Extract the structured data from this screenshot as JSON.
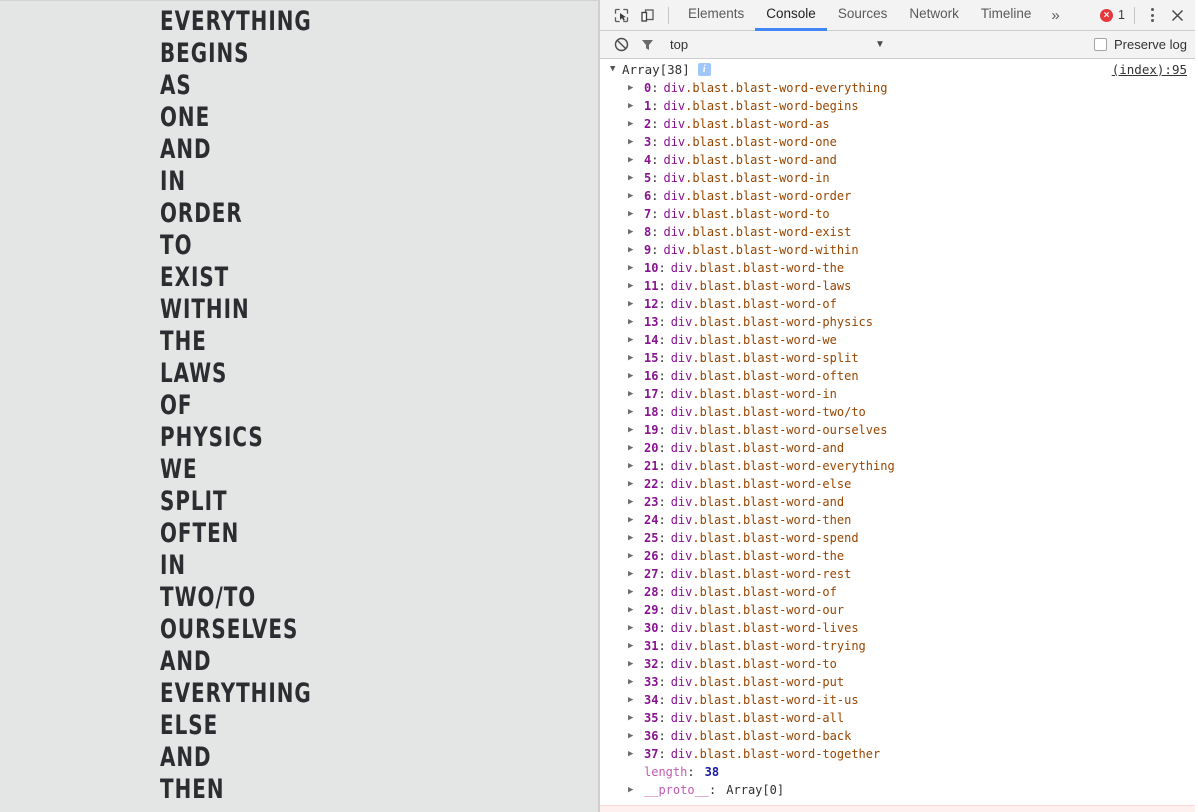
{
  "page": {
    "words": [
      "EVERYTHING",
      "BEGINS",
      "AS",
      "ONE",
      "AND",
      "IN",
      "ORDER",
      "TO",
      "EXIST",
      "WITHIN",
      "THE",
      "LAWS",
      "OF",
      "PHYSICS",
      "WE",
      "SPLIT",
      "OFTEN",
      "IN",
      "TWO/TO",
      "OURSELVES",
      "AND",
      "EVERYTHING",
      "ELSE",
      "AND",
      "THEN"
    ],
    "background_color": "#e4e6e6",
    "text_color": "#2b2d30"
  },
  "devtools": {
    "toolbar": {
      "inspect_icon": "inspect-element-icon",
      "device_icon": "device-toolbar-icon",
      "tabs": [
        {
          "label": "Elements",
          "active": false
        },
        {
          "label": "Console",
          "active": true
        },
        {
          "label": "Sources",
          "active": false
        },
        {
          "label": "Network",
          "active": false
        },
        {
          "label": "Timeline",
          "active": false
        }
      ],
      "more_tabs_label": "»",
      "error_count": "1",
      "error_glyph": "×",
      "error_color": "#e5393e",
      "menu_icon": "kebab-menu-icon",
      "close_glyph": "✕",
      "active_tab_underline_color": "#4285f4"
    },
    "filterbar": {
      "clear_icon": "clear-console-icon",
      "filter_icon": "filter-funnel-icon",
      "context": "top",
      "context_caret": "▼",
      "preserve_log_label": "Preserve log",
      "preserve_log_checked": false
    },
    "console": {
      "group": {
        "toggle": "▼",
        "label": "Array[38]",
        "info_badge": "i",
        "source_link": "(index):95"
      },
      "row_toggle": "▶",
      "entries": [
        {
          "index": "0",
          "tag": "div",
          "classes": ".blast.blast-word-everything"
        },
        {
          "index": "1",
          "tag": "div",
          "classes": ".blast.blast-word-begins"
        },
        {
          "index": "2",
          "tag": "div",
          "classes": ".blast.blast-word-as"
        },
        {
          "index": "3",
          "tag": "div",
          "classes": ".blast.blast-word-one"
        },
        {
          "index": "4",
          "tag": "div",
          "classes": ".blast.blast-word-and"
        },
        {
          "index": "5",
          "tag": "div",
          "classes": ".blast.blast-word-in"
        },
        {
          "index": "6",
          "tag": "div",
          "classes": ".blast.blast-word-order"
        },
        {
          "index": "7",
          "tag": "div",
          "classes": ".blast.blast-word-to"
        },
        {
          "index": "8",
          "tag": "div",
          "classes": ".blast.blast-word-exist"
        },
        {
          "index": "9",
          "tag": "div",
          "classes": ".blast.blast-word-within"
        },
        {
          "index": "10",
          "tag": "div",
          "classes": ".blast.blast-word-the"
        },
        {
          "index": "11",
          "tag": "div",
          "classes": ".blast.blast-word-laws"
        },
        {
          "index": "12",
          "tag": "div",
          "classes": ".blast.blast-word-of"
        },
        {
          "index": "13",
          "tag": "div",
          "classes": ".blast.blast-word-physics"
        },
        {
          "index": "14",
          "tag": "div",
          "classes": ".blast.blast-word-we"
        },
        {
          "index": "15",
          "tag": "div",
          "classes": ".blast.blast-word-split"
        },
        {
          "index": "16",
          "tag": "div",
          "classes": ".blast.blast-word-often"
        },
        {
          "index": "17",
          "tag": "div",
          "classes": ".blast.blast-word-in"
        },
        {
          "index": "18",
          "tag": "div",
          "classes": ".blast.blast-word-two/to"
        },
        {
          "index": "19",
          "tag": "div",
          "classes": ".blast.blast-word-ourselves"
        },
        {
          "index": "20",
          "tag": "div",
          "classes": ".blast.blast-word-and"
        },
        {
          "index": "21",
          "tag": "div",
          "classes": ".blast.blast-word-everything"
        },
        {
          "index": "22",
          "tag": "div",
          "classes": ".blast.blast-word-else"
        },
        {
          "index": "23",
          "tag": "div",
          "classes": ".blast.blast-word-and"
        },
        {
          "index": "24",
          "tag": "div",
          "classes": ".blast.blast-word-then"
        },
        {
          "index": "25",
          "tag": "div",
          "classes": ".blast.blast-word-spend"
        },
        {
          "index": "26",
          "tag": "div",
          "classes": ".blast.blast-word-the"
        },
        {
          "index": "27",
          "tag": "div",
          "classes": ".blast.blast-word-rest"
        },
        {
          "index": "28",
          "tag": "div",
          "classes": ".blast.blast-word-of"
        },
        {
          "index": "29",
          "tag": "div",
          "classes": ".blast.blast-word-our"
        },
        {
          "index": "30",
          "tag": "div",
          "classes": ".blast.blast-word-lives"
        },
        {
          "index": "31",
          "tag": "div",
          "classes": ".blast.blast-word-trying"
        },
        {
          "index": "32",
          "tag": "div",
          "classes": ".blast.blast-word-to"
        },
        {
          "index": "33",
          "tag": "div",
          "classes": ".blast.blast-word-put"
        },
        {
          "index": "34",
          "tag": "div",
          "classes": ".blast.blast-word-it-us"
        },
        {
          "index": "35",
          "tag": "div",
          "classes": ".blast.blast-word-all"
        },
        {
          "index": "36",
          "tag": "div",
          "classes": ".blast.blast-word-back"
        },
        {
          "index": "37",
          "tag": "div",
          "classes": ".blast.blast-word-together"
        }
      ],
      "length_key": "length",
      "length_value": "38",
      "proto_key": "__proto__",
      "proto_value": "Array[0]"
    }
  }
}
